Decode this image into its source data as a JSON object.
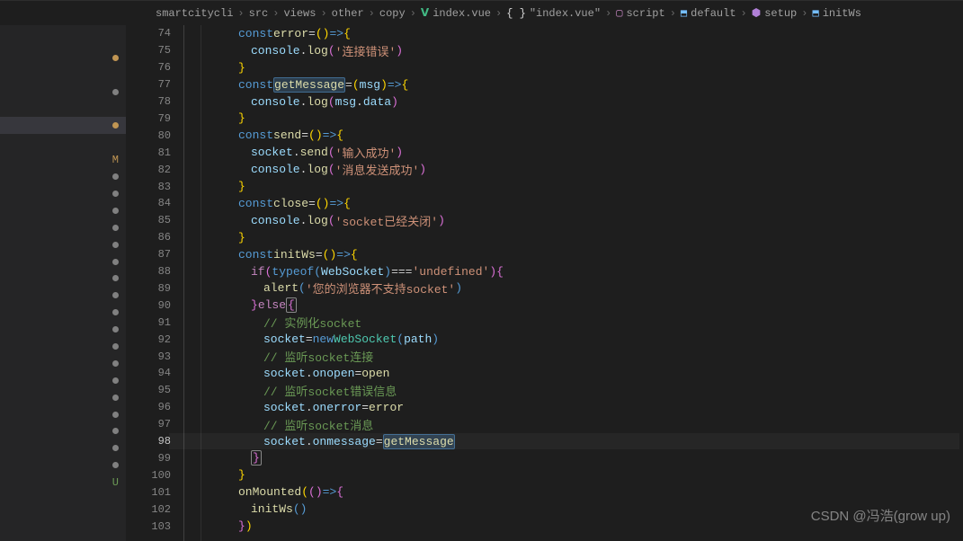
{
  "breadcrumb": {
    "items": [
      {
        "label": "smartcitycli",
        "icon": ""
      },
      {
        "label": "src",
        "icon": ""
      },
      {
        "label": "views",
        "icon": ""
      },
      {
        "label": "other",
        "icon": ""
      },
      {
        "label": "copy",
        "icon": ""
      },
      {
        "label": "index.vue",
        "icon": "vue"
      },
      {
        "label": "\"index.vue\"",
        "icon": "brace"
      },
      {
        "label": "script",
        "icon": "sq"
      },
      {
        "label": "default",
        "icon": "blue"
      },
      {
        "label": "setup",
        "icon": "cube"
      },
      {
        "label": "initWs",
        "icon": "blue"
      }
    ]
  },
  "sidebar": {
    "markers": [
      {
        "type": "dot",
        "color": "amber"
      },
      {
        "type": "dot",
        "color": "gray"
      },
      {
        "type": "dot",
        "color": "amber"
      },
      {
        "type": "text",
        "text": "M",
        "color": "amber"
      },
      {
        "type": "dot",
        "color": "gray"
      },
      {
        "type": "dot",
        "color": "gray"
      },
      {
        "type": "dot",
        "color": "gray"
      },
      {
        "type": "dot",
        "color": "gray"
      },
      {
        "type": "dot",
        "color": "gray"
      },
      {
        "type": "dot",
        "color": "gray"
      },
      {
        "type": "dot",
        "color": "gray"
      },
      {
        "type": "dot",
        "color": "gray"
      },
      {
        "type": "dot",
        "color": "gray"
      },
      {
        "type": "dot",
        "color": "gray"
      },
      {
        "type": "dot",
        "color": "gray"
      },
      {
        "type": "dot",
        "color": "gray"
      },
      {
        "type": "dot",
        "color": "gray"
      },
      {
        "type": "dot",
        "color": "gray"
      },
      {
        "type": "dot",
        "color": "gray"
      },
      {
        "type": "dot",
        "color": "gray"
      },
      {
        "type": "dot",
        "color": "gray"
      },
      {
        "type": "dot",
        "color": "gray"
      },
      {
        "type": "text",
        "text": "U",
        "color": "green"
      }
    ]
  },
  "code": {
    "first_line": 74,
    "active_line": 98,
    "lines": [
      {
        "n": 74,
        "i": 3,
        "t": [
          [
            "tk-kw",
            "const"
          ],
          [
            "sp",
            " "
          ],
          [
            "tk-fn",
            "error"
          ],
          [
            "sp",
            " "
          ],
          [
            "tk-op",
            "="
          ],
          [
            "sp",
            " "
          ],
          [
            "tk-pn",
            "("
          ],
          [
            "tk-pn",
            ")"
          ],
          [
            "sp",
            " "
          ],
          [
            "tk-kw",
            "=>"
          ],
          [
            "sp",
            " "
          ],
          [
            "tk-pn",
            "{"
          ]
        ]
      },
      {
        "n": 75,
        "i": 4,
        "t": [
          [
            "tk-var",
            "console"
          ],
          [
            "tk-op",
            "."
          ],
          [
            "tk-fn",
            "log"
          ],
          [
            "tk-pn2",
            "("
          ],
          [
            "tk-str",
            "'连接错误'"
          ],
          [
            "tk-pn2",
            ")"
          ]
        ]
      },
      {
        "n": 76,
        "i": 3,
        "t": [
          [
            "tk-pn",
            "}"
          ]
        ]
      },
      {
        "n": 77,
        "i": 3,
        "t": [
          [
            "tk-kw",
            "const"
          ],
          [
            "sp",
            " "
          ],
          [
            "tk-fn hl",
            "getMessage"
          ],
          [
            "sp",
            " "
          ],
          [
            "tk-op",
            "="
          ],
          [
            "sp",
            " "
          ],
          [
            "tk-pn",
            "("
          ],
          [
            "tk-var",
            "msg"
          ],
          [
            "tk-pn",
            ")"
          ],
          [
            "sp",
            " "
          ],
          [
            "tk-kw",
            "=>"
          ],
          [
            "sp",
            " "
          ],
          [
            "tk-pn",
            "{"
          ]
        ]
      },
      {
        "n": 78,
        "i": 4,
        "t": [
          [
            "tk-var",
            "console"
          ],
          [
            "tk-op",
            "."
          ],
          [
            "tk-fn",
            "log"
          ],
          [
            "tk-pn2",
            "("
          ],
          [
            "tk-var",
            "msg"
          ],
          [
            "tk-op",
            "."
          ],
          [
            "tk-var",
            "data"
          ],
          [
            "tk-pn2",
            ")"
          ]
        ]
      },
      {
        "n": 79,
        "i": 3,
        "t": [
          [
            "tk-pn",
            "}"
          ]
        ]
      },
      {
        "n": 80,
        "i": 3,
        "t": [
          [
            "tk-kw",
            "const"
          ],
          [
            "sp",
            " "
          ],
          [
            "tk-fn",
            "send"
          ],
          [
            "sp",
            " "
          ],
          [
            "tk-op",
            "="
          ],
          [
            "sp",
            " "
          ],
          [
            "tk-pn",
            "("
          ],
          [
            "tk-pn",
            ")"
          ],
          [
            "sp",
            " "
          ],
          [
            "tk-kw",
            "=>"
          ],
          [
            "sp",
            " "
          ],
          [
            "tk-pn",
            "{"
          ]
        ]
      },
      {
        "n": 81,
        "i": 4,
        "t": [
          [
            "tk-var",
            "socket"
          ],
          [
            "tk-op",
            "."
          ],
          [
            "tk-fn",
            "send"
          ],
          [
            "tk-pn2",
            "("
          ],
          [
            "tk-str",
            "'输入成功'"
          ],
          [
            "tk-pn2",
            ")"
          ]
        ]
      },
      {
        "n": 82,
        "i": 4,
        "t": [
          [
            "tk-var",
            "console"
          ],
          [
            "tk-op",
            "."
          ],
          [
            "tk-fn",
            "log"
          ],
          [
            "tk-pn2",
            "("
          ],
          [
            "tk-str",
            "'消息发送成功'"
          ],
          [
            "tk-pn2",
            ")"
          ]
        ]
      },
      {
        "n": 83,
        "i": 3,
        "t": [
          [
            "tk-pn",
            "}"
          ]
        ]
      },
      {
        "n": 84,
        "i": 3,
        "t": [
          [
            "tk-kw",
            "const"
          ],
          [
            "sp",
            " "
          ],
          [
            "tk-fn",
            "close"
          ],
          [
            "sp",
            " "
          ],
          [
            "tk-op",
            "="
          ],
          [
            "sp",
            " "
          ],
          [
            "tk-pn",
            "("
          ],
          [
            "tk-pn",
            ")"
          ],
          [
            "sp",
            " "
          ],
          [
            "tk-kw",
            "=>"
          ],
          [
            "sp",
            " "
          ],
          [
            "tk-pn",
            "{"
          ]
        ]
      },
      {
        "n": 85,
        "i": 4,
        "t": [
          [
            "tk-var",
            "console"
          ],
          [
            "tk-op",
            "."
          ],
          [
            "tk-fn",
            "log"
          ],
          [
            "tk-pn2",
            "("
          ],
          [
            "tk-str",
            "'socket已经关闭'"
          ],
          [
            "tk-pn2",
            ")"
          ]
        ]
      },
      {
        "n": 86,
        "i": 3,
        "t": [
          [
            "tk-pn",
            "}"
          ]
        ]
      },
      {
        "n": 87,
        "i": 3,
        "t": [
          [
            "tk-kw",
            "const"
          ],
          [
            "sp",
            " "
          ],
          [
            "tk-fn",
            "initWs"
          ],
          [
            "sp",
            " "
          ],
          [
            "tk-op",
            "="
          ],
          [
            "sp",
            " "
          ],
          [
            "tk-pn",
            "("
          ],
          [
            "tk-pn",
            ")"
          ],
          [
            "sp",
            " "
          ],
          [
            "tk-kw",
            "=>"
          ],
          [
            "sp",
            " "
          ],
          [
            "tk-pn",
            "{"
          ]
        ]
      },
      {
        "n": 88,
        "i": 4,
        "t": [
          [
            "tk-kw2",
            "if"
          ],
          [
            "sp",
            " "
          ],
          [
            "tk-pn2",
            "("
          ],
          [
            "tk-kw",
            "typeof"
          ],
          [
            "sp",
            " "
          ],
          [
            "tk-pn3",
            "("
          ],
          [
            "tk-var",
            "WebSocket"
          ],
          [
            "tk-pn3",
            ")"
          ],
          [
            "sp",
            " "
          ],
          [
            "tk-op",
            "==="
          ],
          [
            "sp",
            " "
          ],
          [
            "tk-str",
            "'undefined'"
          ],
          [
            "tk-pn2",
            ")"
          ],
          [
            "sp",
            " "
          ],
          [
            "tk-pn2",
            "{"
          ]
        ]
      },
      {
        "n": 89,
        "i": 5,
        "t": [
          [
            "tk-fn",
            "alert"
          ],
          [
            "tk-pn3",
            "("
          ],
          [
            "tk-str",
            "'您的浏览器不支持socket'"
          ],
          [
            "tk-pn3",
            ")"
          ]
        ]
      },
      {
        "n": 90,
        "i": 4,
        "t": [
          [
            "tk-pn2",
            "}"
          ],
          [
            "sp",
            " "
          ],
          [
            "tk-kw2",
            "else"
          ],
          [
            "sp",
            " "
          ],
          [
            "tk-pn2 boxbr",
            "{"
          ]
        ]
      },
      {
        "n": 91,
        "i": 5,
        "t": [
          [
            "tk-cmt",
            "// 实例化socket"
          ]
        ]
      },
      {
        "n": 92,
        "i": 5,
        "t": [
          [
            "tk-var",
            "socket"
          ],
          [
            "sp",
            " "
          ],
          [
            "tk-op",
            "="
          ],
          [
            "sp",
            " "
          ],
          [
            "tk-kw",
            "new"
          ],
          [
            "sp",
            " "
          ],
          [
            "tk-type",
            "WebSocket"
          ],
          [
            "tk-pn3",
            "("
          ],
          [
            "tk-var",
            "path"
          ],
          [
            "tk-pn3",
            ")"
          ]
        ]
      },
      {
        "n": 93,
        "i": 5,
        "t": [
          [
            "tk-cmt",
            "// 监听socket连接"
          ]
        ]
      },
      {
        "n": 94,
        "i": 5,
        "t": [
          [
            "tk-var",
            "socket"
          ],
          [
            "tk-op",
            "."
          ],
          [
            "tk-var",
            "onopen"
          ],
          [
            "sp",
            " "
          ],
          [
            "tk-op",
            "="
          ],
          [
            "sp",
            " "
          ],
          [
            "tk-fn",
            "open"
          ]
        ]
      },
      {
        "n": 95,
        "i": 5,
        "t": [
          [
            "tk-cmt",
            "// 监听socket错误信息"
          ]
        ]
      },
      {
        "n": 96,
        "i": 5,
        "t": [
          [
            "tk-var",
            "socket"
          ],
          [
            "tk-op",
            "."
          ],
          [
            "tk-var",
            "onerror"
          ],
          [
            "sp",
            " "
          ],
          [
            "tk-op",
            "="
          ],
          [
            "sp",
            " "
          ],
          [
            "tk-fn",
            "error"
          ]
        ]
      },
      {
        "n": 97,
        "i": 5,
        "t": [
          [
            "tk-cmt",
            "// 监听socket消息"
          ]
        ]
      },
      {
        "n": 98,
        "i": 5,
        "t": [
          [
            "tk-var",
            "socket"
          ],
          [
            "tk-op",
            "."
          ],
          [
            "tk-var",
            "onmessage"
          ],
          [
            "sp",
            " "
          ],
          [
            "tk-op",
            "="
          ],
          [
            "sp",
            " "
          ],
          [
            "tk-fn hl",
            "getMessage"
          ]
        ]
      },
      {
        "n": 99,
        "i": 4,
        "t": [
          [
            "tk-pn2 boxbr",
            "}"
          ]
        ]
      },
      {
        "n": 100,
        "i": 3,
        "t": [
          [
            "tk-pn",
            "}"
          ]
        ]
      },
      {
        "n": 101,
        "i": 3,
        "t": [
          [
            "tk-fn",
            "onMounted"
          ],
          [
            "tk-pn",
            "("
          ],
          [
            "tk-pn2",
            "("
          ],
          [
            "tk-pn2",
            ")"
          ],
          [
            "sp",
            " "
          ],
          [
            "tk-kw",
            "=>"
          ],
          [
            "sp",
            " "
          ],
          [
            "tk-pn2",
            "{"
          ]
        ]
      },
      {
        "n": 102,
        "i": 4,
        "t": [
          [
            "tk-fn",
            "initWs"
          ],
          [
            "tk-pn3",
            "("
          ],
          [
            "tk-pn3",
            ")"
          ]
        ]
      },
      {
        "n": 103,
        "i": 3,
        "t": [
          [
            "tk-pn2",
            "}"
          ],
          [
            "tk-pn",
            ")"
          ]
        ]
      }
    ]
  },
  "watermark": "CSDN @冯浩(grow up)"
}
